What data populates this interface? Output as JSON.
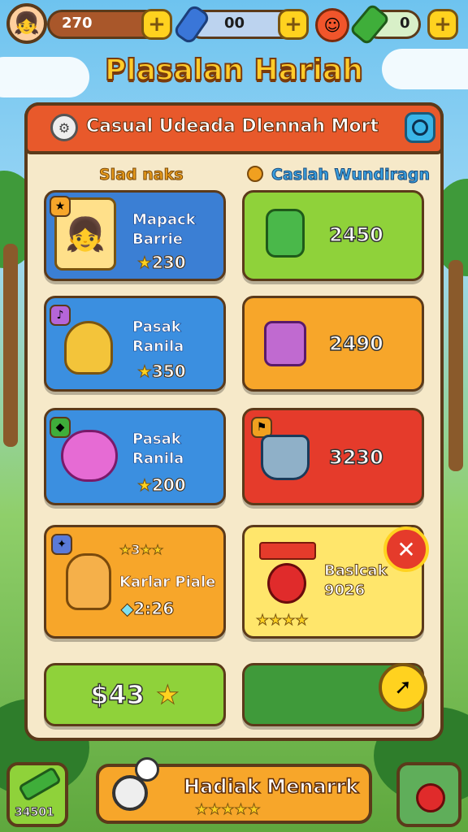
{
  "colors": {
    "panel": "#f6e9c9",
    "header": "#e8592b",
    "blue": "#3b8fe0",
    "green": "#8fd23a",
    "orange": "#f7a62a",
    "red": "#e53b2b",
    "yellow": "#ffe66b"
  },
  "topbar": {
    "coins": "270",
    "gems": "00",
    "energy": "0",
    "avatar_icon": "girl-avatar-icon",
    "add_icon": "plus-icon"
  },
  "title": "Plasalan Hariah",
  "panel": {
    "header": "Casual Udeada Dlennah Mort",
    "left_heading": "Slad naks",
    "right_heading": "Caslah Wundiragn"
  },
  "cards_left": [
    {
      "name": "Mapack\nBarrie",
      "price": "230",
      "icon": "girl-portrait-icon"
    },
    {
      "name": "Pasak\nRanila",
      "price": "350",
      "icon": "yellow-creature-icon"
    },
    {
      "name": "Pasak\nRanila",
      "price": "200",
      "icon": "pink-creature-icon"
    },
    {
      "name": "Karlar Piale",
      "price": "2:26",
      "rating": "3",
      "icon": "orange-cat-icon"
    }
  ],
  "cards_right": [
    {
      "value": "2450",
      "icon": "green-jug-icon"
    },
    {
      "value": "2490",
      "icon": "purple-suitcase-icon"
    },
    {
      "value": "3230",
      "icon": "blue-cauldron-icon"
    },
    {
      "name": "Baslcak\n9026",
      "icon": "red-apple-icon"
    }
  ],
  "buy_button": "$43",
  "bottom": {
    "left_count": "34501",
    "center_label": "Hadiak Menarrk"
  }
}
